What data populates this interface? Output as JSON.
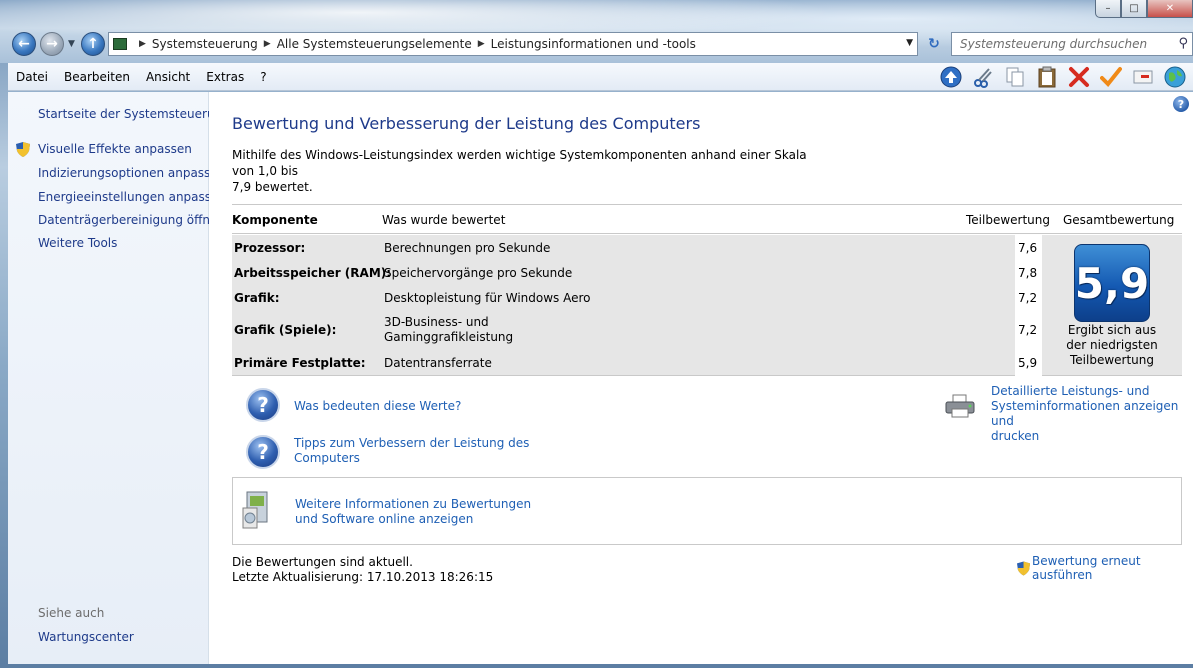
{
  "window": {
    "caption": {
      "minimize": "–",
      "maximize": "□",
      "close": "✕"
    }
  },
  "nav": {
    "back_icon": "back-arrow-icon",
    "forward_icon": "forward-arrow-icon",
    "up_icon": "up-arrow-icon",
    "breadcrumb": [
      "Systemsteuerung",
      "Alle Systemsteuerungselemente",
      "Leistungsinformationen und -tools"
    ],
    "search_placeholder": "Systemsteuerung durchsuchen"
  },
  "menu": [
    "Datei",
    "Bearbeiten",
    "Ansicht",
    "Extras",
    "?"
  ],
  "toolbar_icons": [
    "up-icon",
    "cut-icon",
    "copy-icon",
    "paste-icon",
    "delete-icon",
    "checkmark-icon",
    "email-icon",
    "globe-icon"
  ],
  "sidebar": {
    "home": "Startseite der Systemsteuerung",
    "tasks": [
      "Visuelle Effekte anpassen",
      "Indizierungsoptionen anpassen",
      "Energieeinstellungen anpassen",
      "Datenträgerbereinigung öffnen",
      "Weitere Tools"
    ],
    "see_also_label": "Siehe auch",
    "see_also": [
      "Wartungscenter"
    ]
  },
  "main": {
    "title": "Bewertung und Verbesserung der Leistung des Computers",
    "intro_line1": "Mithilfe des Windows-Leistungsindex werden wichtige Systemkomponenten anhand einer Skala von 1,0 bis",
    "intro_line2": "7,9 bewertet.",
    "table": {
      "headers": {
        "component": "Komponente",
        "rated": "Was wurde bewertet",
        "subscore": "Teilbewertung",
        "base": "Gesamtbewertung"
      },
      "rows": [
        {
          "component": "Prozessor:",
          "desc1": "Berechnungen pro Sekunde",
          "desc2": "",
          "score": "7,6"
        },
        {
          "component": "Arbeitsspeicher (RAM):",
          "desc1": "Speichervorgänge pro Sekunde",
          "desc2": "",
          "score": "7,8"
        },
        {
          "component": "Grafik:",
          "desc1": "Desktopleistung für Windows Aero",
          "desc2": "",
          "score": "7,2"
        },
        {
          "component": "Grafik (Spiele):",
          "desc1": "3D-Business- und",
          "desc2": "Gaminggrafikleistung",
          "score": "7,2"
        },
        {
          "component": "Primäre Festplatte:",
          "desc1": "Datentransferrate",
          "desc2": "",
          "score": "5,9"
        }
      ],
      "base_score": "5,9",
      "base_caption_1": "Ergibt sich aus",
      "base_caption_2": "der niedrigsten",
      "base_caption_3": "Teilbewertung"
    },
    "links": {
      "what_mean": "Was bedeuten diese Werte?",
      "tips_1": "Tipps zum Verbessern der Leistung des",
      "tips_2": "Computers",
      "details_1": "Detaillierte Leistungs- und",
      "details_2": "Systeminformationen anzeigen und",
      "details_3": "drucken",
      "online_1": "Weitere Informationen zu Bewertungen",
      "online_2": "und Software online anzeigen"
    },
    "status_current": "Die Bewertungen sind aktuell.",
    "status_last": "Letzte Aktualisierung: 17.10.2013 18:26:15",
    "rerun": "Bewertung erneut ausführen"
  },
  "colors": {
    "link": "#1e5fb4",
    "title": "#1e3a8a",
    "badge": "#1459b2"
  }
}
